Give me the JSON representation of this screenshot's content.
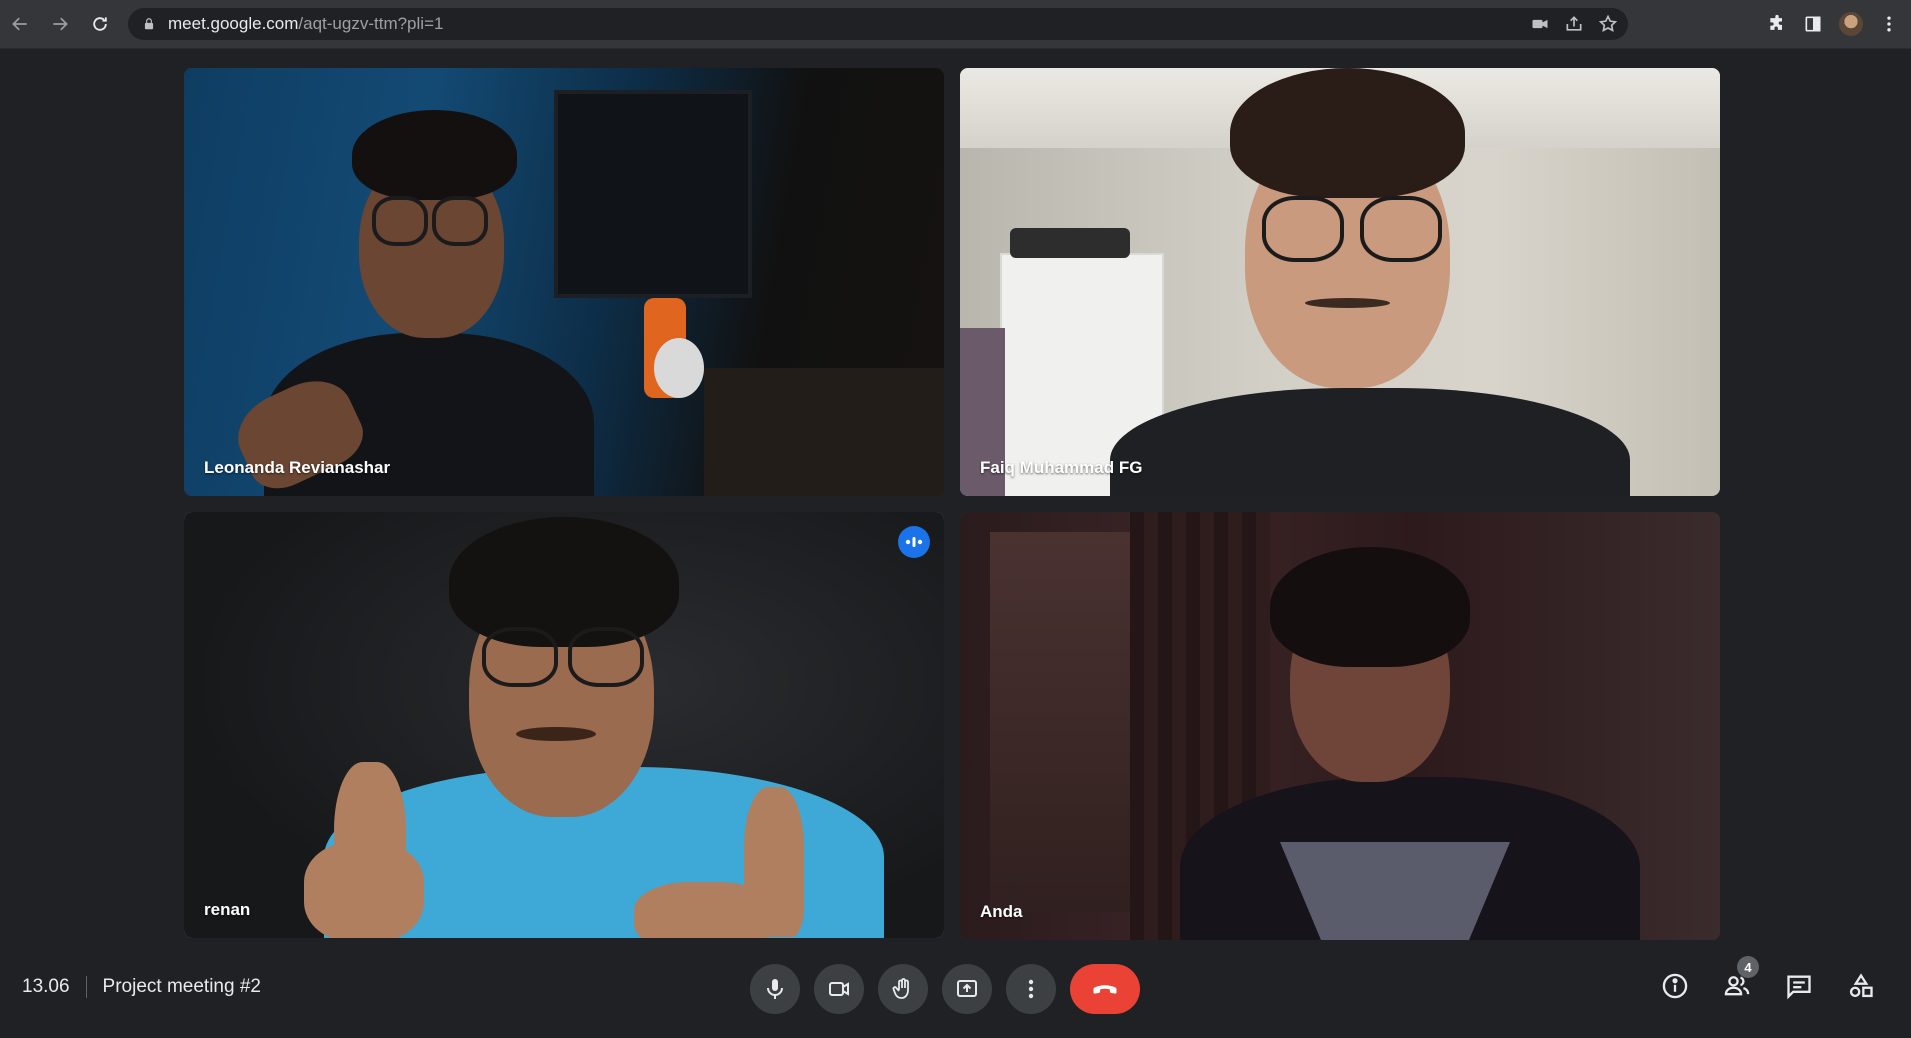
{
  "browser": {
    "url_host": "meet.google.com",
    "url_path": "/aqt-ugzv-ttm?pli=1"
  },
  "tiles": [
    {
      "name": "Leonanda Revianashar",
      "speaking": false
    },
    {
      "name": "Faiq Muhammad FG",
      "speaking": false
    },
    {
      "name": "renan",
      "speaking": true
    },
    {
      "name": "Anda",
      "speaking": false
    }
  ],
  "meeting": {
    "time": "13.06",
    "title": "Project meeting #2"
  },
  "controls": {
    "participants_count": "4",
    "end_call_color": "#ea4335",
    "accent": "#1a73e8",
    "icons": [
      "mic-icon",
      "camera-icon",
      "raise-hand-icon",
      "present-icon",
      "more-options-icon",
      "end-call-icon"
    ]
  },
  "right_panel_icons": [
    "info-icon",
    "people-icon",
    "chat-icon",
    "activities-icon"
  ]
}
